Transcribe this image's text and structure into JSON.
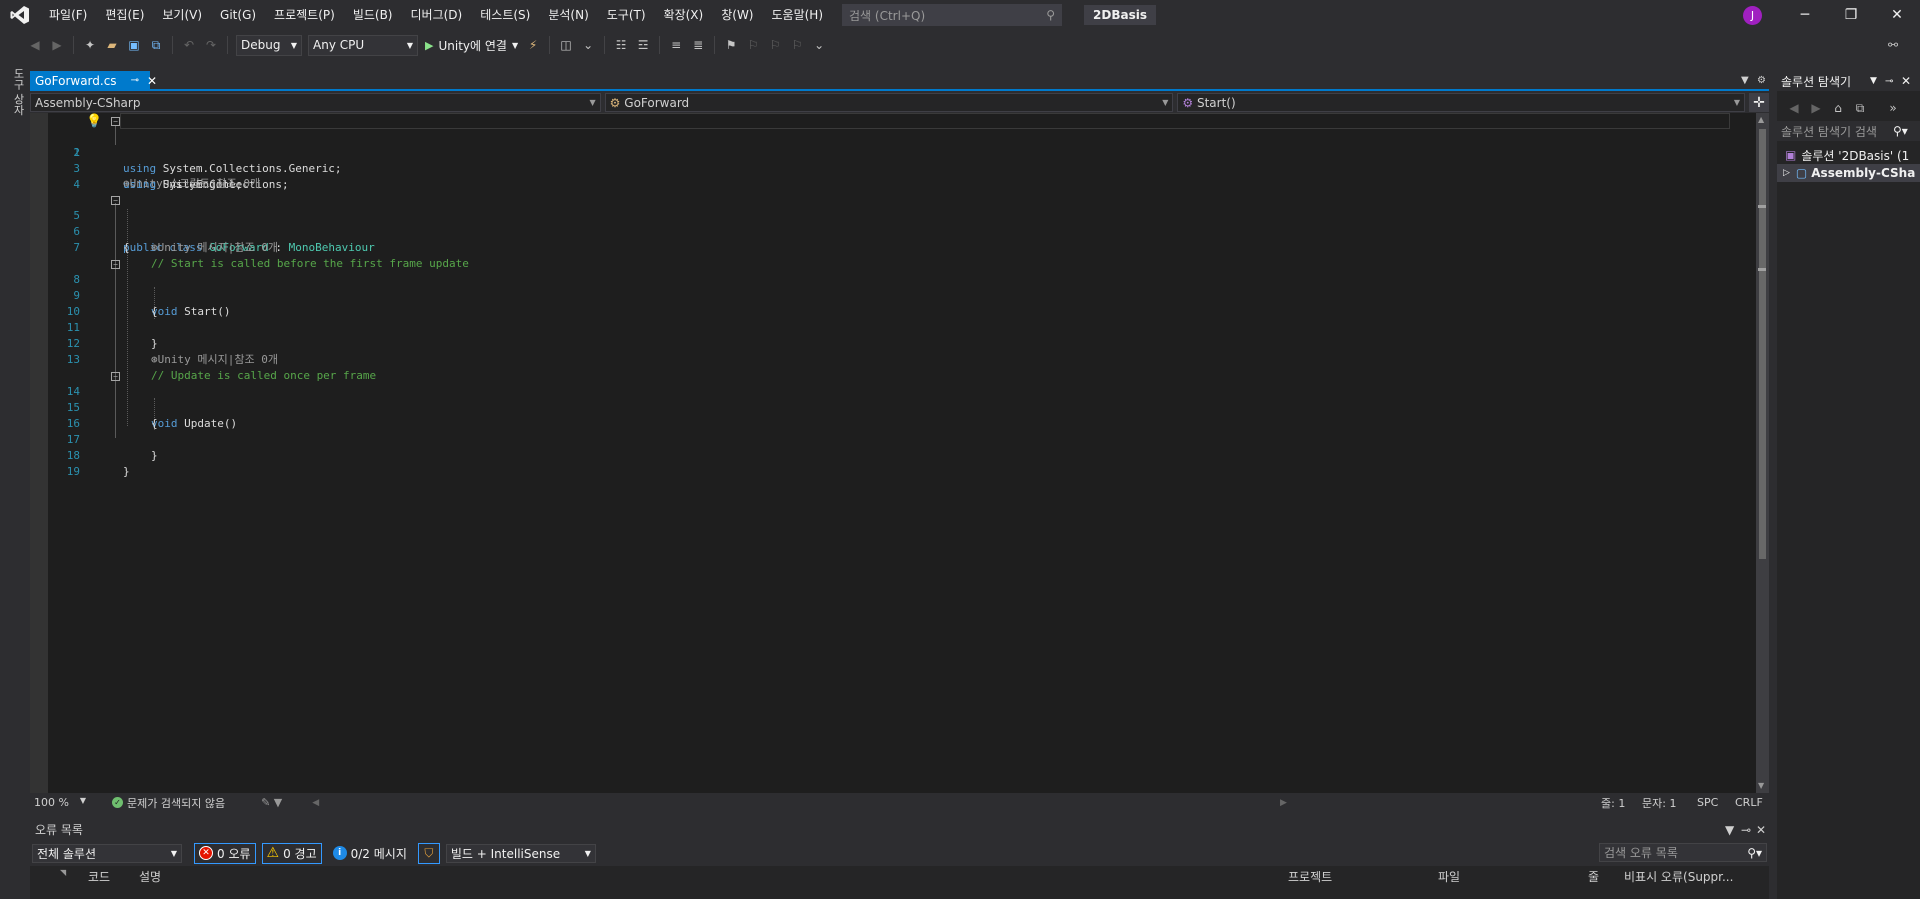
{
  "menu": {
    "items": [
      "파일(F)",
      "편집(E)",
      "보기(V)",
      "Git(G)",
      "프로젝트(P)",
      "빌드(B)",
      "디버그(D)",
      "테스트(S)",
      "분석(N)",
      "도구(T)",
      "확장(X)",
      "창(W)",
      "도움말(H)"
    ],
    "search_placeholder": "검색 (Ctrl+Q)",
    "solution_name": "2DBasis",
    "avatar_letter": "J"
  },
  "toolbar": {
    "configuration": "Debug",
    "platform": "Any CPU",
    "run_label": "Unity에 연결"
  },
  "left_strip": {
    "label": "도구 상자"
  },
  "editor_tab": {
    "filename": "GoForward.cs"
  },
  "navbar": {
    "project": "Assembly-CSharp",
    "type": "GoForward",
    "member": "Start()"
  },
  "code": {
    "line_numbers": [
      "1",
      "2",
      "3",
      "4",
      "5",
      "6",
      "7",
      "8",
      "9",
      "10",
      "11",
      "12",
      "13",
      "14",
      "15",
      "16",
      "17",
      "18",
      "19"
    ],
    "l1_kw": "using",
    "l1_rest": " System.Collections;",
    "l2_kw": "using",
    "l2_rest": " System.Collections.Generic;",
    "l3_kw": "using",
    "l3_rest": " UnityEngine;",
    "lens_class": "Unity 스크립트|참조 0개",
    "l5_kw": "public class",
    "l5_name": "GoForward",
    "l5_colon": " : ",
    "l5_base": "MonoBehaviour",
    "l6": "{",
    "l7_comment": "// Start is called before the first frame update",
    "lens_start": "Unity 메시지|참조 0개",
    "l8_kw": "void",
    "l8_rest": " Start()",
    "l9": "{",
    "l11": "}",
    "l13_comment": "// Update is called once per frame",
    "lens_update": "Unity 메시지|참조 0개",
    "l14_kw": "void",
    "l14_rest": " Update()",
    "l15": "{",
    "l17": "}",
    "l18": "}"
  },
  "editor_status": {
    "zoom": "100 %",
    "issues": "문제가 검색되지 않음",
    "line": "줄: 1",
    "col": "문자: 1",
    "spc": "SPC",
    "eol": "CRLF"
  },
  "error_list": {
    "title": "오류 목록",
    "scope": "전체 솔루션",
    "errors": "0 오류",
    "warnings": "0 경고",
    "messages": "0/2 메시지",
    "source": "빌드 + IntelliSense",
    "search_placeholder": "검색 오류 목록",
    "columns": [
      "코드",
      "설명",
      "프로젝트",
      "파일",
      "줄",
      "비표시 오류(Suppr..."
    ]
  },
  "solution_explorer": {
    "title": "솔루션 탐색기",
    "search_placeholder": "솔루션 탐색기 검색",
    "solution_node": "솔루션 '2DBasis' (1",
    "project_node": "Assembly-CSha"
  },
  "colors": {
    "accent": "#007acc",
    "keyword": "#569cd6",
    "type": "#4ec9b0",
    "comment": "#57a64a",
    "line_number": "#2b91af",
    "background": "#1e1e1e"
  }
}
